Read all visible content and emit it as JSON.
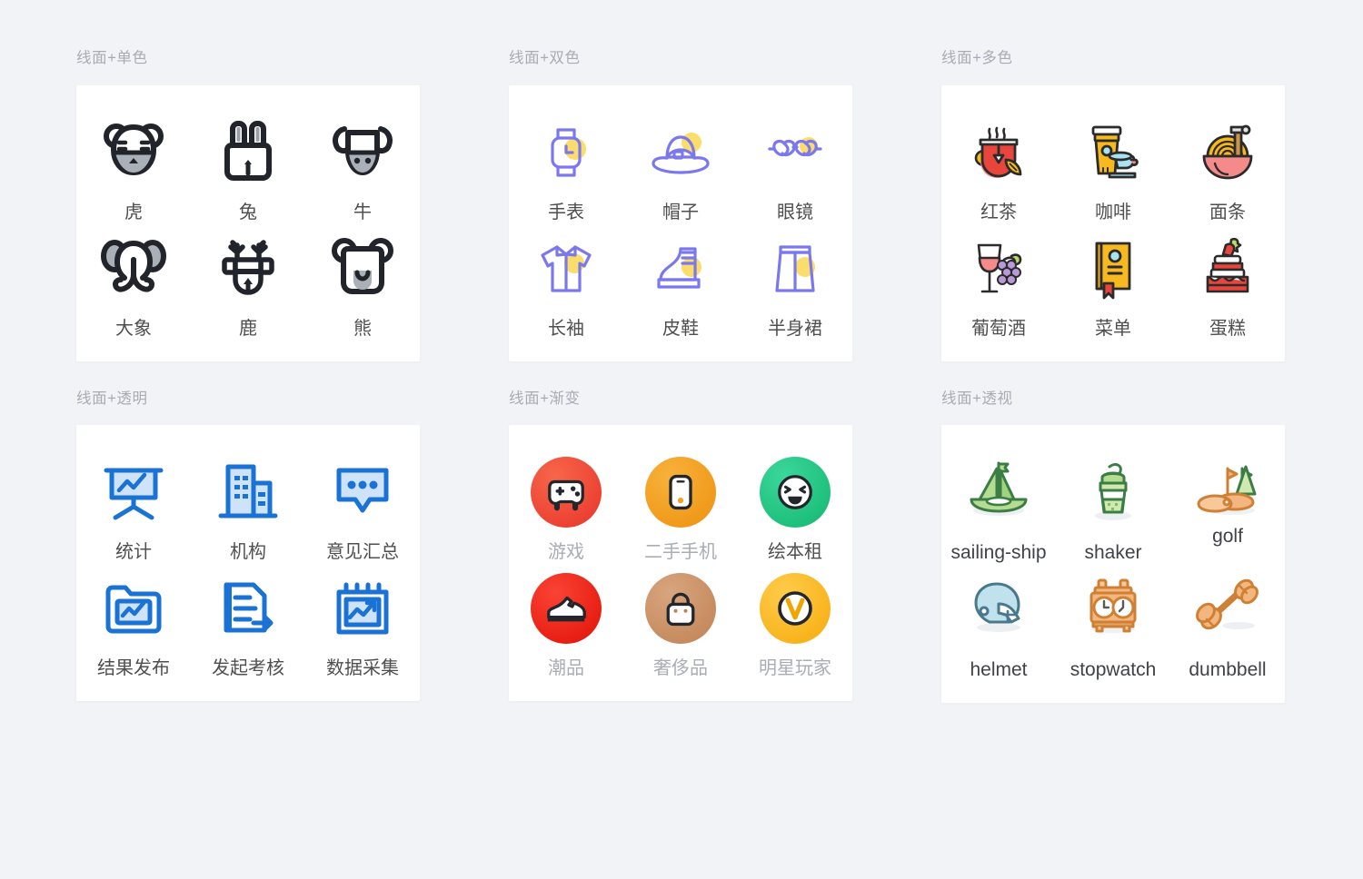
{
  "page": {
    "background": "#f2f3f7",
    "card_background": "#ffffff",
    "section_label_color": "#a7abb4",
    "caption_color": "#4f4f4f",
    "muted_caption_color": "#a9adb6"
  },
  "sections": [
    {
      "id": "mono",
      "label": "线面+单色",
      "style": "monochrome",
      "palette": {
        "line": "#21242a",
        "fill": "#aab0b8"
      },
      "items": [
        {
          "icon": "tiger-icon",
          "label": "虎"
        },
        {
          "icon": "rabbit-icon",
          "label": "兔"
        },
        {
          "icon": "ox-icon",
          "label": "牛"
        },
        {
          "icon": "elephant-icon",
          "label": "大象"
        },
        {
          "icon": "deer-icon",
          "label": "鹿"
        },
        {
          "icon": "bear-icon",
          "label": "熊"
        }
      ]
    },
    {
      "id": "duo",
      "label": "线面+双色",
      "style": "two-tone",
      "palette": {
        "line": "#7b78ee",
        "accent": "#fbdd6b"
      },
      "items": [
        {
          "icon": "watch-icon",
          "label": "手表"
        },
        {
          "icon": "hat-icon",
          "label": "帽子"
        },
        {
          "icon": "glasses-icon",
          "label": "眼镜"
        },
        {
          "icon": "shirt-icon",
          "label": "长袖"
        },
        {
          "icon": "boot-icon",
          "label": "皮鞋"
        },
        {
          "icon": "skirt-icon",
          "label": "半身裙"
        }
      ]
    },
    {
      "id": "multi",
      "label": "线面+多色",
      "style": "multicolor",
      "palette": {
        "line": "#2b2b2b",
        "red": "#e8453c",
        "yellow": "#f7b820",
        "cyan": "#a8e4ef",
        "pink": "#f58a8a",
        "purple": "#b89ad8"
      },
      "items": [
        {
          "icon": "black-tea-icon",
          "label": "红茶"
        },
        {
          "icon": "coffee-icon",
          "label": "咖啡"
        },
        {
          "icon": "noodles-icon",
          "label": "面条"
        },
        {
          "icon": "wine-icon",
          "label": "葡萄酒"
        },
        {
          "icon": "menu-book-icon",
          "label": "菜单"
        },
        {
          "icon": "cake-icon",
          "label": "蛋糕"
        }
      ]
    },
    {
      "id": "transparent",
      "label": "线面+透明",
      "style": "transparent",
      "palette": {
        "line": "#1a73d4",
        "fill": "#cfe3f8"
      },
      "items": [
        {
          "icon": "statistics-board-icon",
          "label": "统计"
        },
        {
          "icon": "organization-icon",
          "label": "机构"
        },
        {
          "icon": "feedback-summary-icon",
          "label": "意见汇总"
        },
        {
          "icon": "result-publish-icon",
          "label": "结果发布"
        },
        {
          "icon": "start-review-icon",
          "label": "发起考核"
        },
        {
          "icon": "data-collect-icon",
          "label": "数据采集"
        }
      ]
    },
    {
      "id": "gradient",
      "label": "线面+渐变",
      "style": "gradient",
      "items": [
        {
          "icon": "gamepad-icon",
          "label": "游戏",
          "muted": true,
          "from": "#f4563a",
          "to": "#e8342a"
        },
        {
          "icon": "phone-icon",
          "label": "二手手机",
          "muted": true,
          "from": "#f5a623",
          "to": "#ef9113"
        },
        {
          "icon": "happy-face-icon",
          "label": "绘本租",
          "muted": false,
          "from": "#2fc989",
          "to": "#16b874"
        },
        {
          "icon": "sneaker-icon",
          "label": "潮品",
          "muted": true,
          "from": "#f6261c",
          "to": "#e01207"
        },
        {
          "icon": "luxury-bag-icon",
          "label": "奢侈品",
          "muted": true,
          "from": "#cf9a72",
          "to": "#c08254"
        },
        {
          "icon": "vip-badge-icon",
          "label": "明星玩家",
          "muted": true,
          "from": "#ffc233",
          "to": "#f7ae12"
        }
      ]
    },
    {
      "id": "perspective",
      "label": "线面+透视",
      "style": "perspective",
      "palette": {
        "green_line": "#3c7d45",
        "green_fill": "#b5dd92",
        "orange_line": "#d08035",
        "orange_fill": "#f2b67e",
        "blue_line": "#4a788c",
        "blue_fill": "#bfe2ec"
      },
      "items": [
        {
          "icon": "sailing-ship-icon",
          "label": "sailing-ship",
          "raise": false
        },
        {
          "icon": "shaker-icon",
          "label": "shaker",
          "raise": false
        },
        {
          "icon": "golf-icon",
          "label": "golf",
          "raise": true
        },
        {
          "icon": "helmet-icon",
          "label": "helmet",
          "raise": false
        },
        {
          "icon": "stopwatch-icon",
          "label": "stopwatch",
          "raise": false
        },
        {
          "icon": "dumbbell-icon",
          "label": "dumbbell",
          "raise": false
        }
      ]
    }
  ]
}
